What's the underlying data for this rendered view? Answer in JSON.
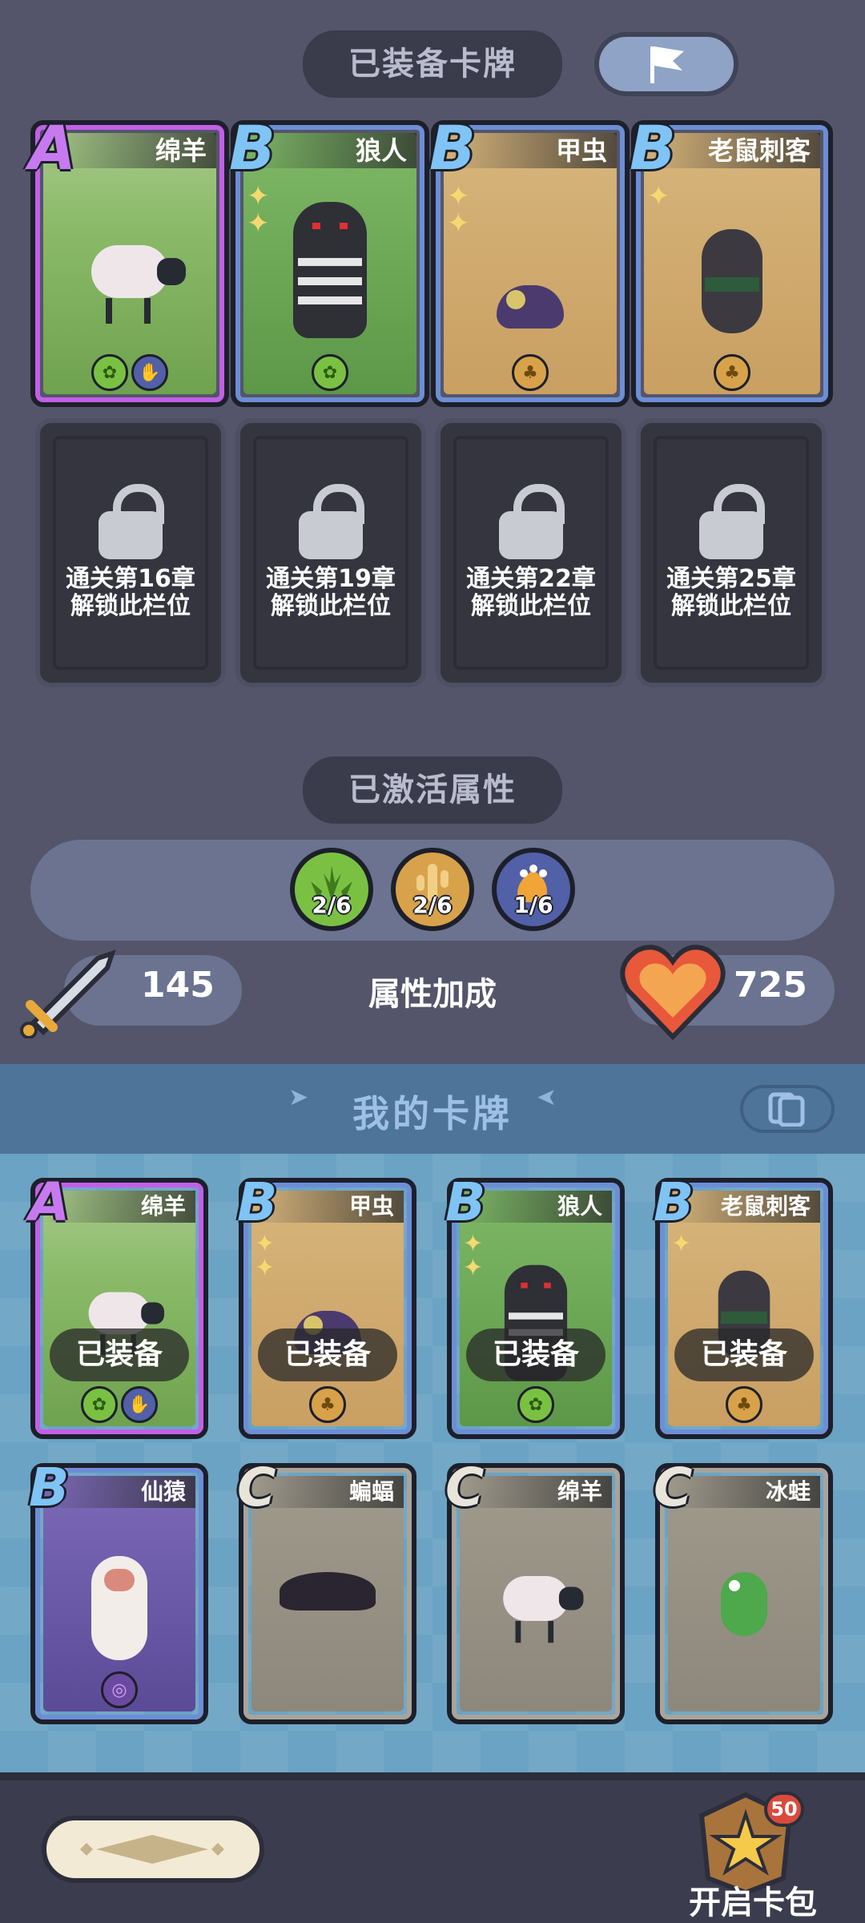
{
  "equipped_section": {
    "title": "已装备卡牌",
    "cards": [
      {
        "rank": "A",
        "name": "绵羊",
        "stars": 0,
        "badges": [
          "grass-icon",
          "beast-icon"
        ]
      },
      {
        "rank": "B",
        "name": "狼人",
        "stars": 2,
        "badges": [
          "grass-icon"
        ]
      },
      {
        "rank": "B",
        "name": "甲虫",
        "stars": 2,
        "badges": [
          "desert-icon"
        ]
      },
      {
        "rank": "B",
        "name": "老鼠刺客",
        "stars": 1,
        "badges": [
          "desert-icon"
        ]
      }
    ],
    "locked_slots": [
      {
        "line1": "通关第16章",
        "line2": "解锁此栏位"
      },
      {
        "line1": "通关第19章",
        "line2": "解锁此栏位"
      },
      {
        "line1": "通关第22章",
        "line2": "解锁此栏位"
      },
      {
        "line1": "通关第25章",
        "line2": "解锁此栏位"
      }
    ]
  },
  "attributes_section": {
    "title": "已激活属性",
    "traits": [
      {
        "icon": "grass-icon",
        "count": "2/6",
        "color": "#7ac143"
      },
      {
        "icon": "cactus-icon",
        "count": "2/6",
        "color": "#d8a24a"
      },
      {
        "icon": "beast-paw-icon",
        "count": "1/6",
        "color": "#5260a8"
      }
    ],
    "attack_value": "145",
    "bonus_label": "属性加成",
    "health_value": "725"
  },
  "my_cards_section": {
    "title": "我的卡牌",
    "equipped_label": "已装备",
    "cards": [
      {
        "rank": "A",
        "name": "绵羊",
        "equipped": true,
        "stars": 0,
        "badges": [
          "grass-icon",
          "beast-icon"
        ]
      },
      {
        "rank": "B",
        "name": "甲虫",
        "equipped": true,
        "stars": 2,
        "badges": [
          "desert-icon"
        ]
      },
      {
        "rank": "B",
        "name": "狼人",
        "equipped": true,
        "stars": 2,
        "badges": [
          "grass-icon"
        ]
      },
      {
        "rank": "B",
        "name": "老鼠刺客",
        "equipped": true,
        "stars": 1,
        "badges": [
          "desert-icon"
        ]
      },
      {
        "rank": "B",
        "name": "仙猿",
        "equipped": false,
        "stars": 0,
        "badges": [
          "spirit-icon"
        ]
      },
      {
        "rank": "C",
        "name": "蝙蝠",
        "equipped": false,
        "stars": 0,
        "badges": []
      },
      {
        "rank": "C",
        "name": "绵羊",
        "equipped": false,
        "stars": 0,
        "badges": []
      },
      {
        "rank": "C",
        "name": "冰蛙",
        "equipped": false,
        "stars": 0,
        "badges": []
      }
    ]
  },
  "bottom_bar": {
    "open_pack_label": "开启卡包",
    "pack_count": "50"
  },
  "colors": {
    "rank_a": "#c160e8",
    "rank_b": "#6c8ed6",
    "rank_c": "#a8a49b",
    "heart": "#e8583a",
    "panel_blue": "#6aa3c4"
  }
}
